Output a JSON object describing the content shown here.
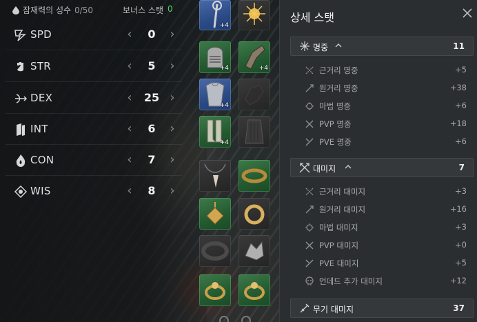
{
  "topbar": {
    "potential_label": "잠재력의 성수",
    "potential_value": "0/50",
    "bonus_label": "보너스 스탯",
    "bonus_value": "0"
  },
  "stats": [
    {
      "label": "SPD",
      "value": "0",
      "icon": "lightning-icon"
    },
    {
      "label": "STR",
      "value": "5",
      "icon": "fist-icon"
    },
    {
      "label": "DEX",
      "value": "25",
      "icon": "bow-icon"
    },
    {
      "label": "INT",
      "value": "6",
      "icon": "book-icon"
    },
    {
      "label": "CON",
      "value": "7",
      "icon": "flame-icon"
    },
    {
      "label": "WIS",
      "value": "8",
      "icon": "eye-icon"
    }
  ],
  "equipment": [
    {
      "name": "staff",
      "enhance": "+4",
      "color": "blue"
    },
    {
      "name": "sun-orb",
      "enhance": "",
      "color": "dark"
    },
    {
      "name": "helmet",
      "enhance": "+4",
      "color": "green"
    },
    {
      "name": "gauntlet",
      "enhance": "+4",
      "color": "green"
    },
    {
      "name": "armor",
      "enhance": "+4",
      "color": "blue"
    },
    {
      "name": "empty-glove",
      "enhance": "",
      "color": "dark"
    },
    {
      "name": "boots",
      "enhance": "+4",
      "color": "green"
    },
    {
      "name": "cape",
      "enhance": "",
      "color": "dark"
    },
    {
      "name": "necklace",
      "enhance": "",
      "color": "dark"
    },
    {
      "name": "bracelet",
      "enhance": "",
      "color": "green"
    },
    {
      "name": "earring",
      "enhance": "",
      "color": "green"
    },
    {
      "name": "ring-gold",
      "enhance": "",
      "color": "dark"
    },
    {
      "name": "belt",
      "enhance": "",
      "color": "dark"
    },
    {
      "name": "dragon-charm",
      "enhance": "",
      "color": "dark"
    },
    {
      "name": "ring-left",
      "enhance": "",
      "color": "green"
    },
    {
      "name": "ring-right",
      "enhance": "",
      "color": "green"
    }
  ],
  "panel": {
    "title": "상세 스탯",
    "groups": [
      {
        "label": "명중",
        "value": "11",
        "items": [
          {
            "label": "근거리 명중",
            "value": "+5"
          },
          {
            "label": "원거리 명중",
            "value": "+38"
          },
          {
            "label": "마법 명중",
            "value": "+6"
          },
          {
            "label": "PVP 명중",
            "value": "+18"
          },
          {
            "label": "PVE 명중",
            "value": "+6"
          }
        ]
      },
      {
        "label": "대미지",
        "value": "7",
        "items": [
          {
            "label": "근거리 대미지",
            "value": "+3"
          },
          {
            "label": "원거리 대미지",
            "value": "+16"
          },
          {
            "label": "마법 대미지",
            "value": "+3"
          },
          {
            "label": "PVP 대미지",
            "value": "+0"
          },
          {
            "label": "PVE 대미지",
            "value": "+5"
          },
          {
            "label": "언데드 추가 대미지",
            "value": "+12"
          }
        ]
      },
      {
        "label": "무기 대미지",
        "value": "37",
        "items": []
      }
    ]
  },
  "colors": {
    "bonus_value": "#4fcf6c",
    "panel_bg": "#2b2e31",
    "slot_green": "#2f6a3b",
    "slot_blue": "#34579a"
  }
}
